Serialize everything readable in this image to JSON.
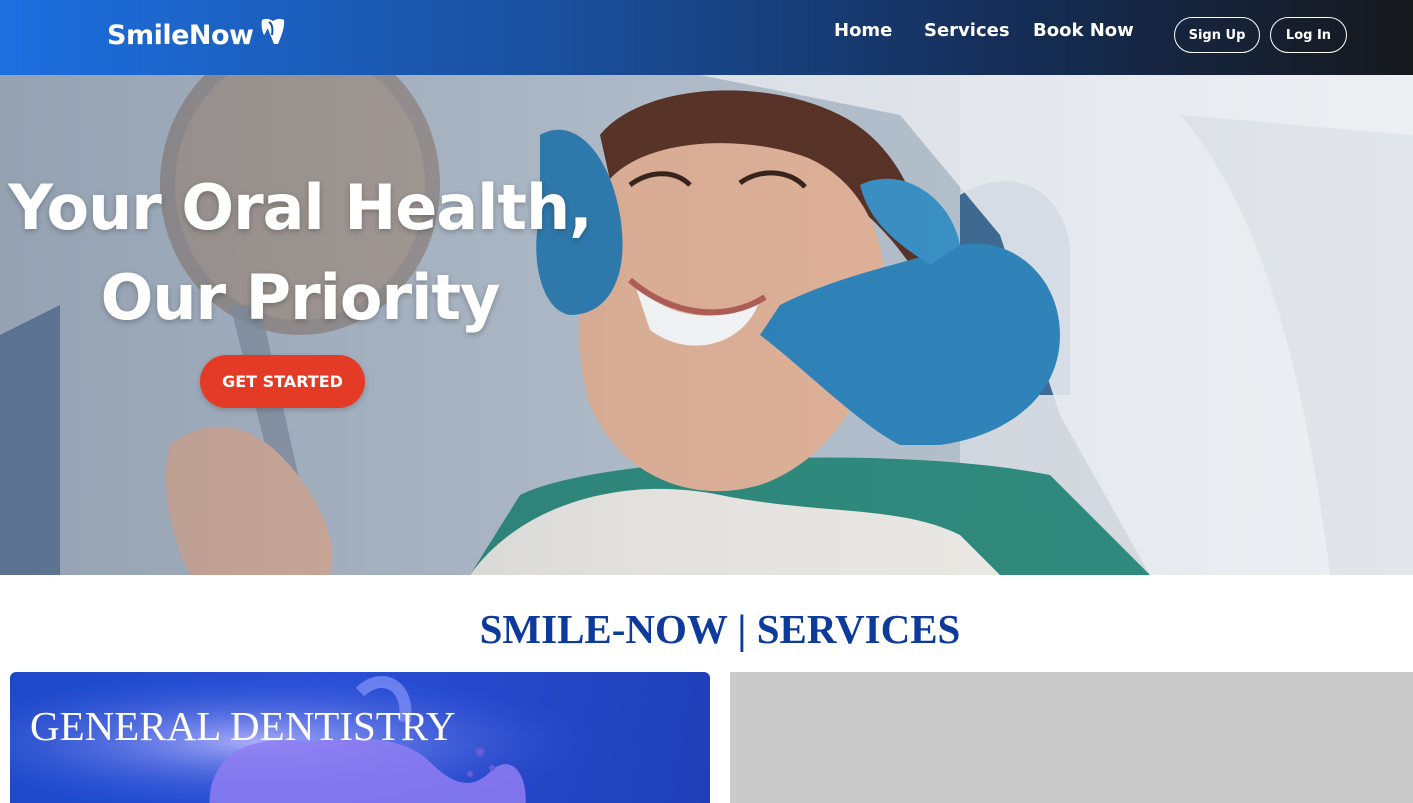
{
  "header": {
    "logo_text": "SmileNow",
    "nav": [
      "Home",
      "Services",
      "Book Now"
    ],
    "sign_up_label": "Sign Up",
    "log_in_label": "Log In"
  },
  "hero": {
    "title_line1": "Your Oral Health,",
    "title_line2": "Our Priority",
    "cta_label": "GET STARTED"
  },
  "services": {
    "heading": "SMILE-NOW | SERVICES",
    "cards": [
      {
        "title": "GENERAL DENTISTRY"
      }
    ]
  },
  "colors": {
    "cta": "#e43b26",
    "heading": "#0c3b9c",
    "card": "#1d49c9",
    "header_start": "#1d6fe0",
    "header_end": "#16181c"
  },
  "icons": [
    "smilenow-logo-icon"
  ]
}
